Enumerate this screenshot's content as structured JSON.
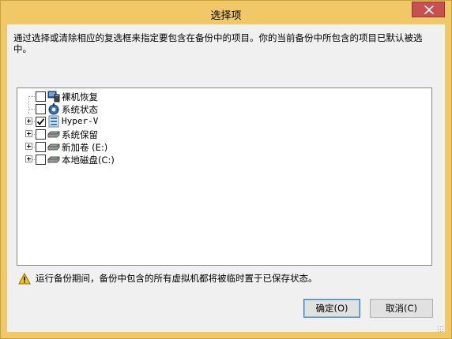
{
  "window": {
    "title": "选择项",
    "title_bar_color": "#f0c868",
    "close_color": "#c75050"
  },
  "instruction": "通过选择或清除相应的复选框来指定要包含在备份中的项目。你的当前备份中所包含的项目已默认被选中。",
  "tree": {
    "items": [
      {
        "label": "裸机恢复",
        "checked": false,
        "expandable": false,
        "icon": "bare-metal-recovery-icon"
      },
      {
        "label": "系统状态",
        "checked": false,
        "expandable": false,
        "icon": "system-state-icon"
      },
      {
        "label": "Hyper-V",
        "checked": true,
        "expandable": true,
        "icon": "hyper-v-icon"
      },
      {
        "label": "系统保留",
        "checked": false,
        "expandable": true,
        "icon": "drive-icon"
      },
      {
        "label": "新加卷 (E:)",
        "checked": false,
        "expandable": true,
        "icon": "drive-icon"
      },
      {
        "label": "本地磁盘(C:)",
        "checked": false,
        "expandable": true,
        "icon": "drive-icon"
      }
    ]
  },
  "warning": {
    "icon": "warning-icon",
    "text": "运行备份期间，备份中包含的所有虚拟机都将被临时置于已保存状态。"
  },
  "buttons": {
    "ok": "确定(O)",
    "cancel": "取消(C)"
  }
}
